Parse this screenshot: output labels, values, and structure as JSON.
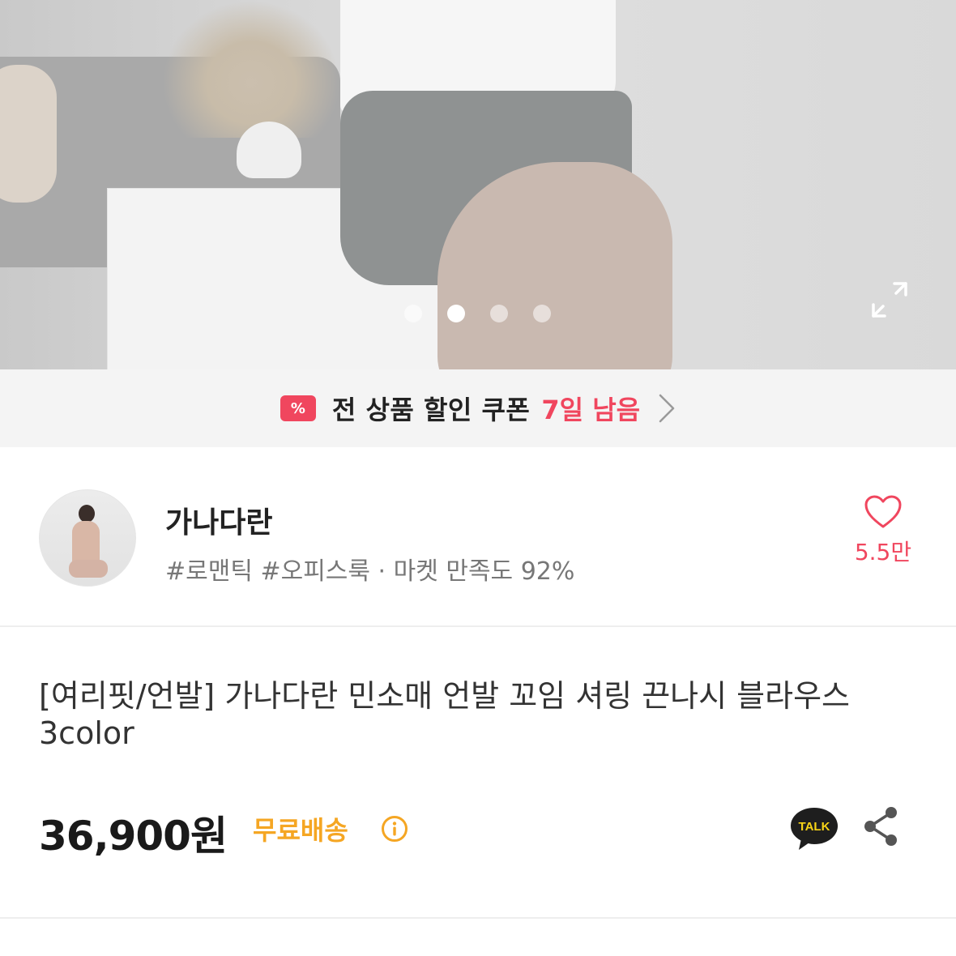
{
  "gallery": {
    "image_count": 4,
    "active_index": 1
  },
  "coupon": {
    "badge": "%",
    "text": "전 상품 할인 쿠폰",
    "remaining": "7일 남음"
  },
  "seller": {
    "name": "가나다란",
    "tags": "#로맨틱 #오피스룩 · 마켓 만족도 92%",
    "likes": "5.5만"
  },
  "product": {
    "title": "[여리핏/언발] 가나다란 민소매 언발 꼬임 셔링 끈나시 블라우스 3color",
    "price": "36,900원",
    "shipping": "무료배송",
    "talk_label": "TALK"
  },
  "colors": {
    "accent": "#f0465e",
    "shipping": "#f5a623",
    "talk": "#1e1e1e"
  }
}
